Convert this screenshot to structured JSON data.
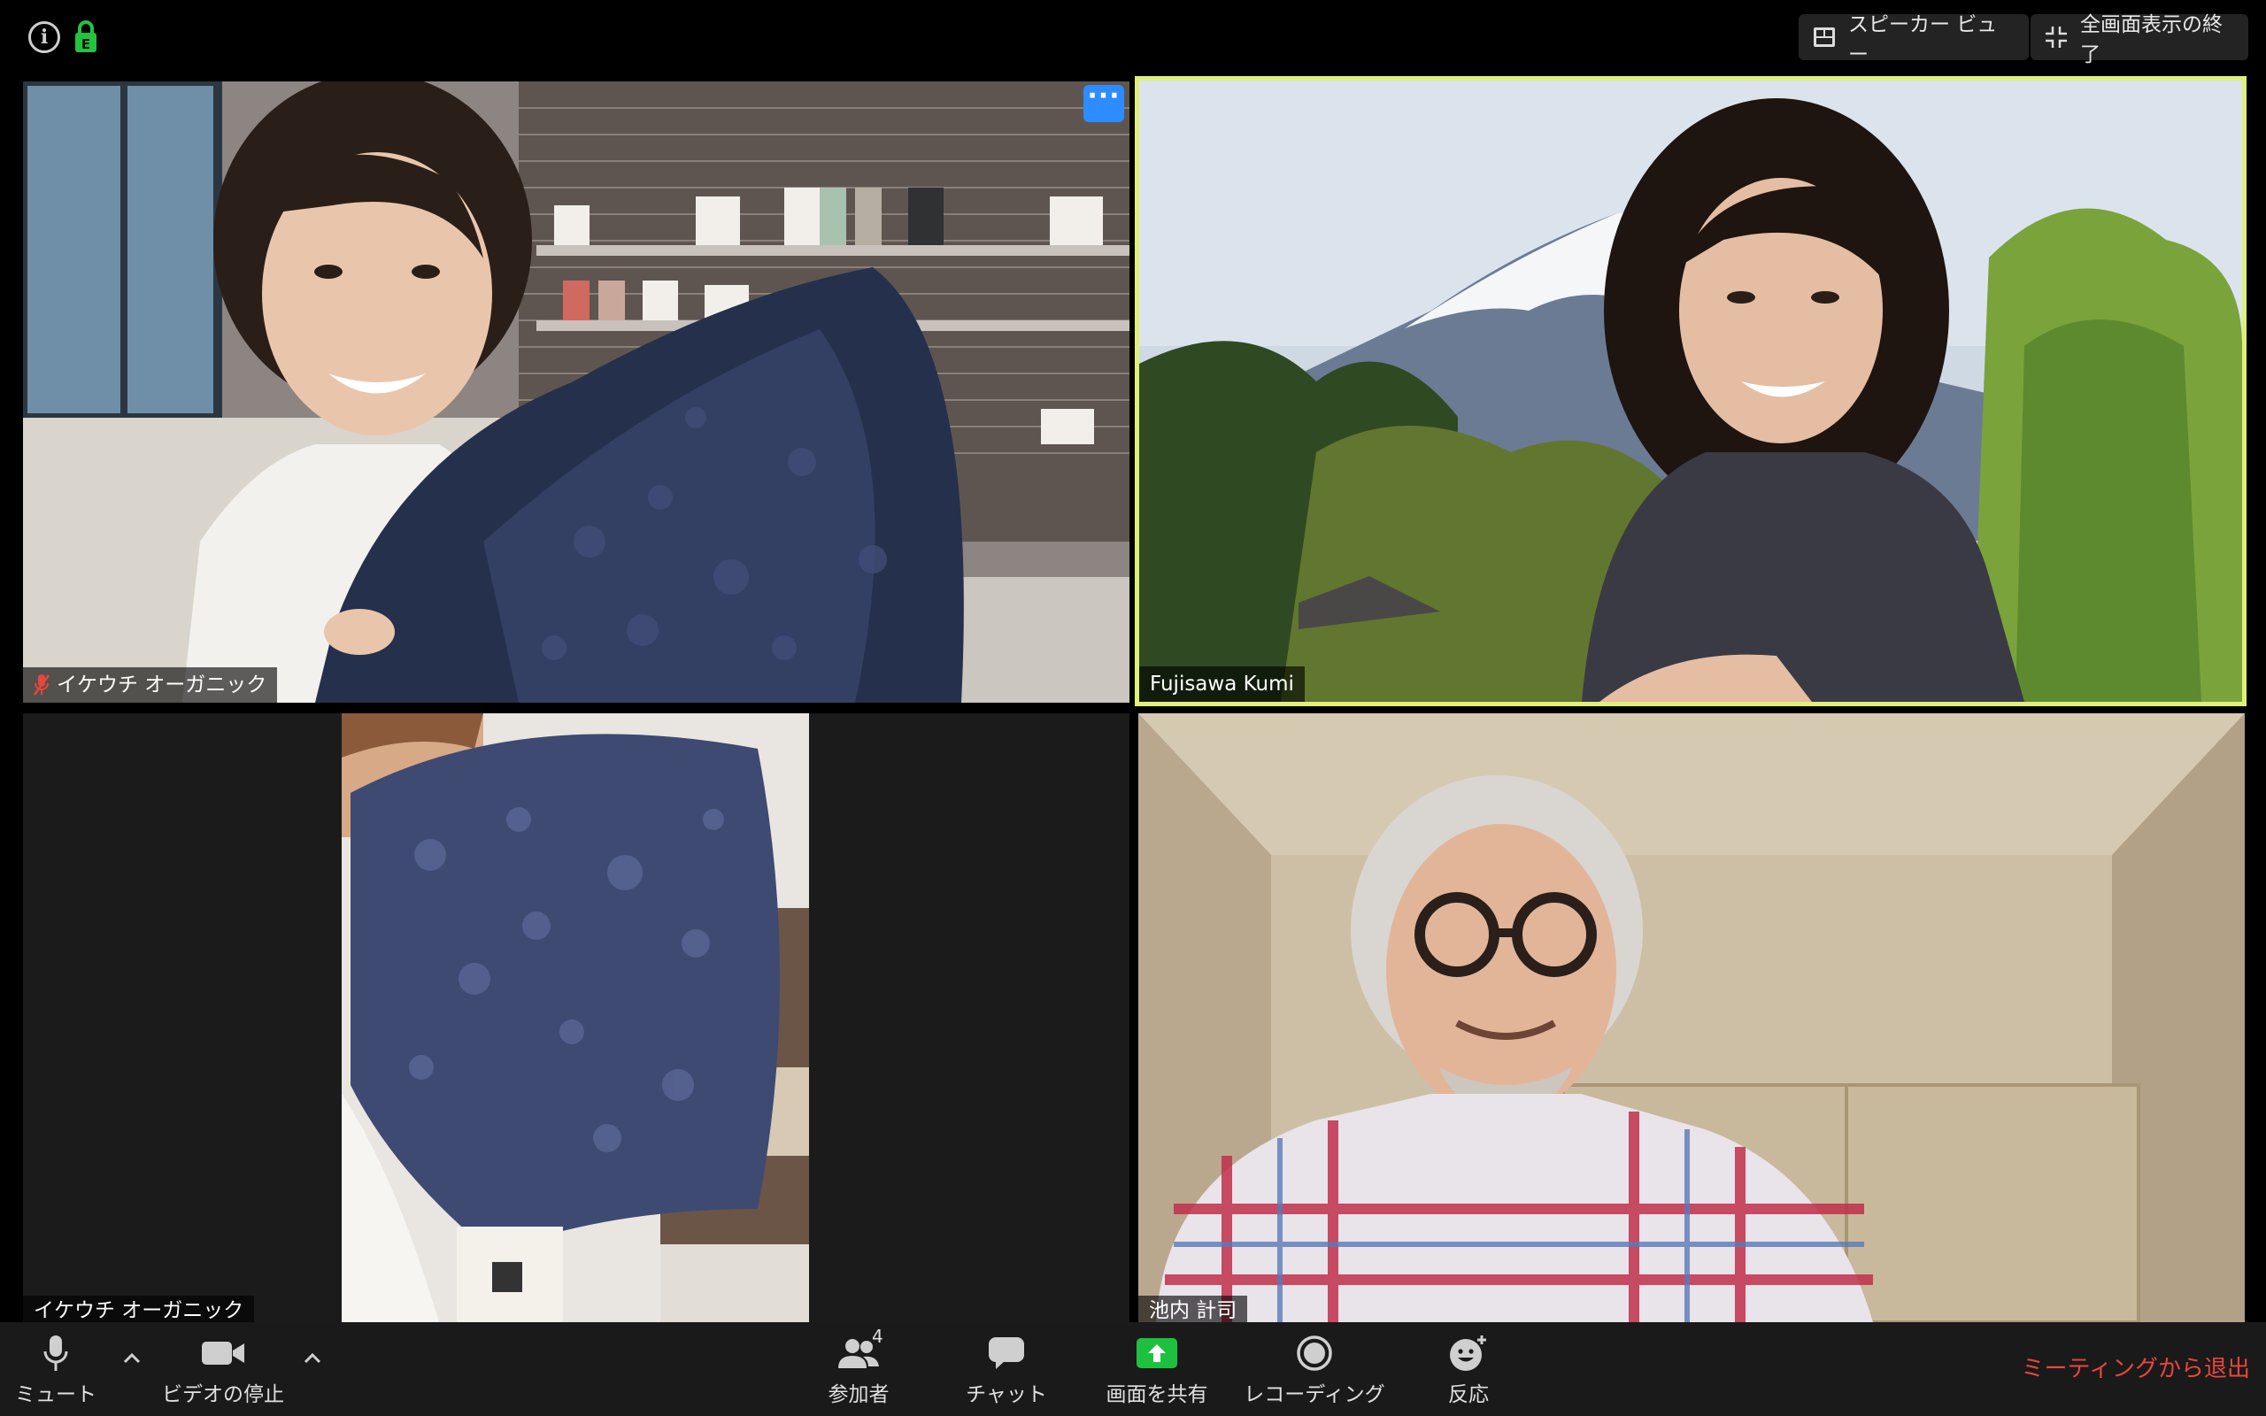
{
  "top_bar": {
    "speaker_view_label": "スピーカー ビュー",
    "exit_fullscreen_label": "全画面表示の終了"
  },
  "participants": [
    {
      "name": "イケウチ オーガニック",
      "muted": true,
      "active_speaker": false
    },
    {
      "name": "Fujisawa Kumi",
      "muted": false,
      "active_speaker": true
    },
    {
      "name": "イケウチ オーガニック",
      "muted": false,
      "active_speaker": false
    },
    {
      "name": "池内 計司",
      "muted": false,
      "active_speaker": false
    }
  ],
  "toolbar": {
    "mute_label": "ミュート",
    "video_label": "ビデオの停止",
    "participants_label": "参加者",
    "participants_count": "4",
    "chat_label": "チャット",
    "share_label": "画面を共有",
    "record_label": "レコーディング",
    "reactions_label": "反応",
    "leave_label": "ミーティングから退出"
  },
  "colors": {
    "active_speaker_border": "#dff07a",
    "share_green": "#1ec13f",
    "leave_red": "#e8463c",
    "more_button_blue": "#2d8cff"
  },
  "icons": [
    "info-icon",
    "encryption-lock-icon",
    "speaker-view-grid-icon",
    "exit-fullscreen-icon",
    "more-options-icon",
    "muted-mic-icon",
    "microphone-icon",
    "video-camera-icon",
    "participants-icon",
    "chat-bubble-icon",
    "share-screen-arrow-icon",
    "record-icon",
    "reaction-emoji-icon"
  ]
}
